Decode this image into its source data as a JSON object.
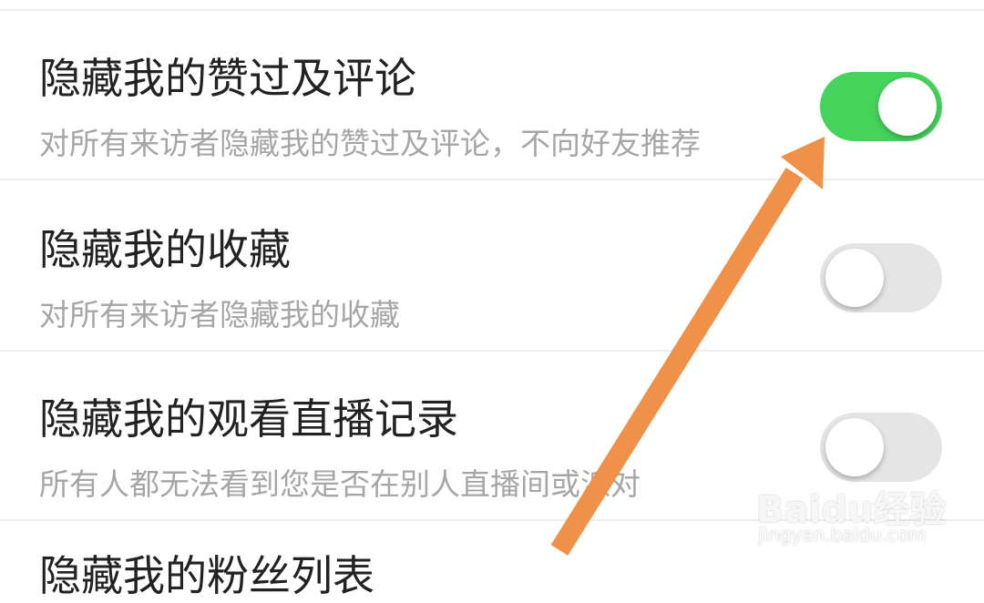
{
  "settings": [
    {
      "title": "隐藏我的赞过及评论",
      "description": "对所有来访者隐藏我的赞过及评论，不向好友推荐",
      "toggle_on": true
    },
    {
      "title": "隐藏我的收藏",
      "description": "对所有来访者隐藏我的收藏",
      "toggle_on": false
    },
    {
      "title": "隐藏我的观看直播记录",
      "description": "所有人都无法看到您是否在别人直播间或派对",
      "toggle_on": false
    },
    {
      "title": "隐藏我的粉丝列表"
    }
  ],
  "colors": {
    "toggle_on": "#44d35b",
    "toggle_off": "#e5e5e5",
    "annotation_arrow": "#f0914a"
  },
  "watermark": {
    "logo": "Baidu经验",
    "url": "jingyan.baidu.com"
  }
}
